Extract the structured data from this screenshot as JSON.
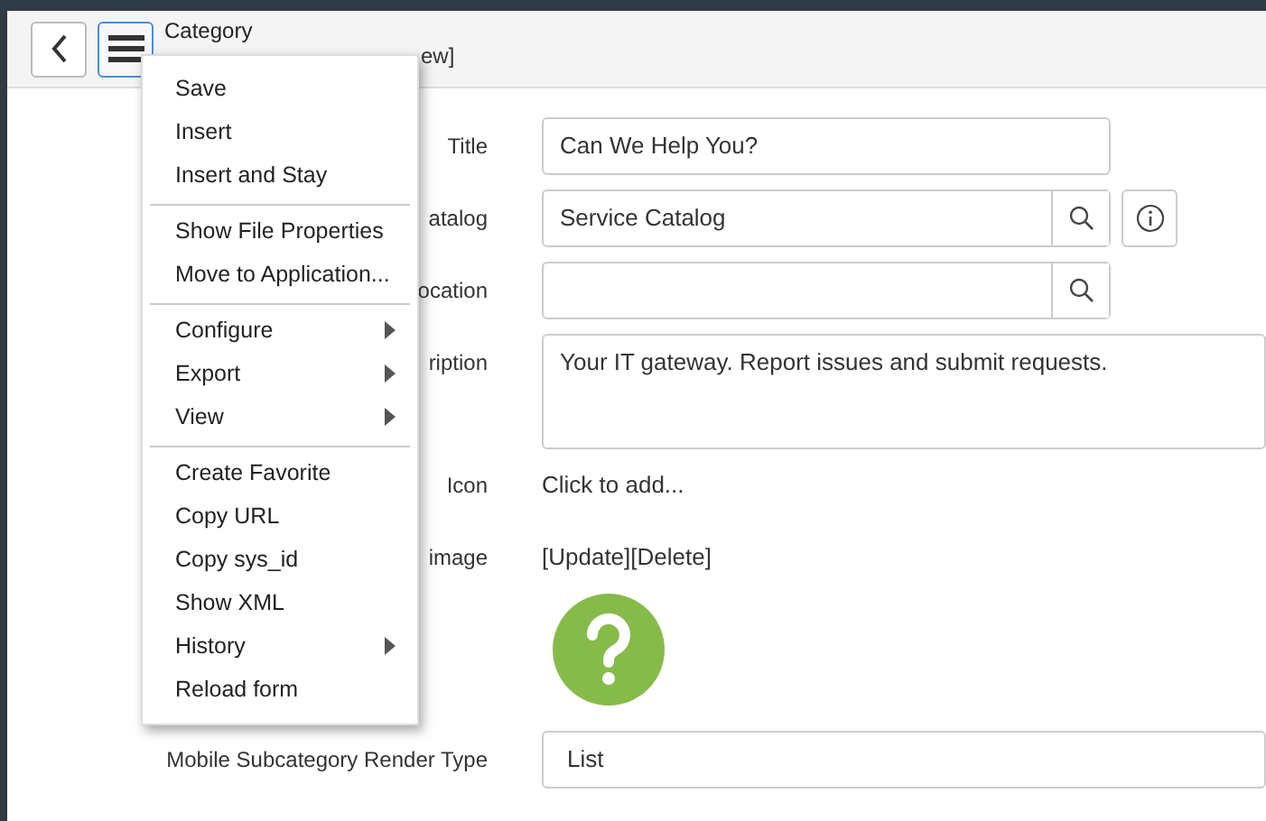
{
  "header": {
    "title": "Category",
    "subtitle_fragment": "ew]"
  },
  "context_menu": {
    "groups": [
      {
        "items": [
          {
            "label": "Save",
            "submenu": false
          },
          {
            "label": "Insert",
            "submenu": false
          },
          {
            "label": "Insert and Stay",
            "submenu": false
          }
        ]
      },
      {
        "items": [
          {
            "label": "Show File Properties",
            "submenu": false
          },
          {
            "label": "Move to Application...",
            "submenu": false
          }
        ]
      },
      {
        "items": [
          {
            "label": "Configure",
            "submenu": true
          },
          {
            "label": "Export",
            "submenu": true
          },
          {
            "label": "View",
            "submenu": true
          }
        ]
      },
      {
        "items": [
          {
            "label": "Create Favorite",
            "submenu": false
          },
          {
            "label": "Copy URL",
            "submenu": false
          },
          {
            "label": "Copy sys_id",
            "submenu": false
          },
          {
            "label": "Show XML",
            "submenu": false
          },
          {
            "label": "History",
            "submenu": true
          },
          {
            "label": "Reload form",
            "submenu": false
          }
        ]
      }
    ]
  },
  "form": [
    {
      "kind": "text",
      "label": "Title",
      "value": "Can We Help You?"
    },
    {
      "kind": "reference",
      "label": "atalog",
      "value": "Service Catalog",
      "info": true
    },
    {
      "kind": "reference",
      "label": "ocation",
      "info": false
    },
    {
      "kind": "textarea",
      "label": "ription",
      "value": "Your IT gateway. Report issues and submit requests."
    },
    {
      "kind": "link",
      "label": "Icon",
      "value": "Click to add..."
    },
    {
      "kind": "image",
      "label": "image",
      "value": "[Update][Delete]"
    },
    {
      "kind": "select",
      "label": "Mobile Subcategory Render Type",
      "value": "List"
    }
  ]
}
